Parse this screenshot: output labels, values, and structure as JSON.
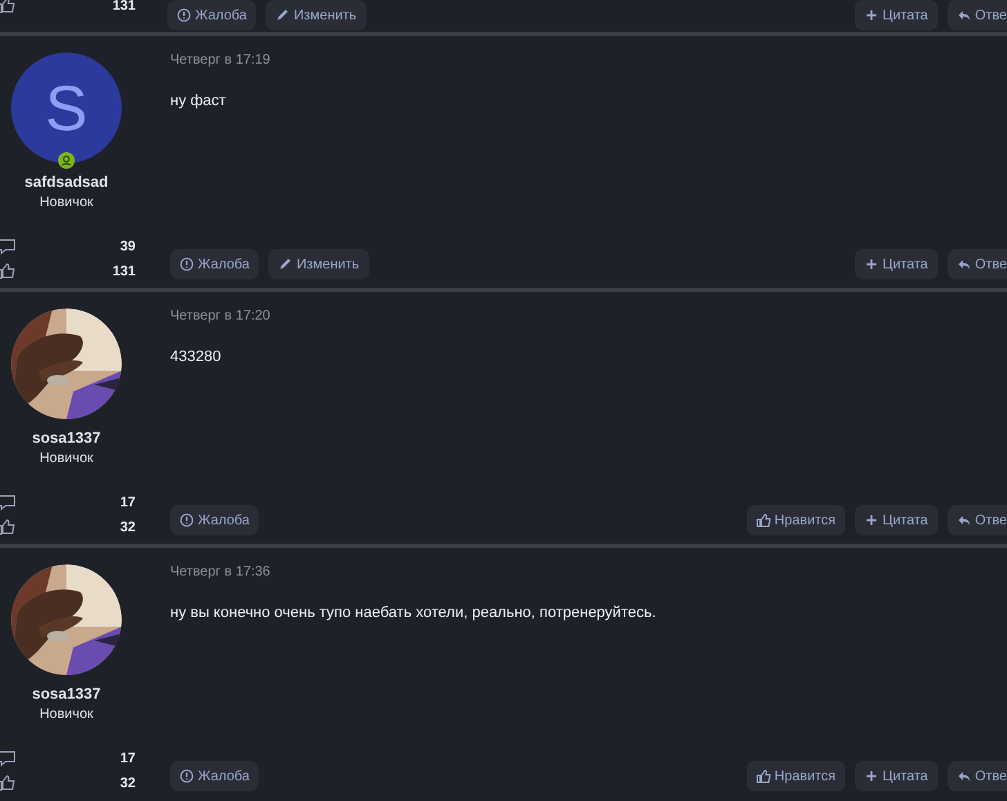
{
  "top_post": {
    "likes": "131",
    "left_buttons": [
      {
        "label": "Жалоба",
        "kind": "report"
      },
      {
        "label": "Изменить",
        "kind": "edit"
      }
    ],
    "right_buttons": [
      {
        "label": "Цитата",
        "kind": "quote"
      },
      {
        "label": "Отве",
        "kind": "reply"
      }
    ]
  },
  "posts": [
    {
      "author": "safdsadsad",
      "rank": "Новичок",
      "online": true,
      "avatar": {
        "kind": "letter",
        "letter": "S"
      },
      "messages": "39",
      "likes": "131",
      "date": "Четверг в 17:19",
      "text": "ну фаст",
      "left_buttons": [
        {
          "label": "Жалоба",
          "kind": "report"
        },
        {
          "label": "Изменить",
          "kind": "edit"
        }
      ],
      "right_buttons": [
        {
          "label": "Цитата",
          "kind": "quote"
        },
        {
          "label": "Отве",
          "kind": "reply"
        }
      ]
    },
    {
      "author": "sosa1337",
      "rank": "Новичок",
      "online": false,
      "avatar": {
        "kind": "picture"
      },
      "messages": "17",
      "likes": "32",
      "date": "Четверг в 17:20",
      "text": "433280",
      "left_buttons": [
        {
          "label": "Жалоба",
          "kind": "report"
        }
      ],
      "right_buttons": [
        {
          "label": "Нравится",
          "kind": "like"
        },
        {
          "label": "Цитата",
          "kind": "quote"
        },
        {
          "label": "Отве",
          "kind": "reply"
        }
      ]
    },
    {
      "author": "sosa1337",
      "rank": "Новичок",
      "online": false,
      "avatar": {
        "kind": "picture"
      },
      "messages": "17",
      "likes": "32",
      "date": "Четверг в 17:36",
      "text": "ну вы конечно очень тупо наебать хотели, реально, потренеруйтесь.",
      "left_buttons": [
        {
          "label": "Жалоба",
          "kind": "report"
        }
      ],
      "right_buttons": [
        {
          "label": "Нравится",
          "kind": "like"
        },
        {
          "label": "Цитата",
          "kind": "quote"
        },
        {
          "label": "Отве",
          "kind": "reply"
        }
      ]
    }
  ]
}
